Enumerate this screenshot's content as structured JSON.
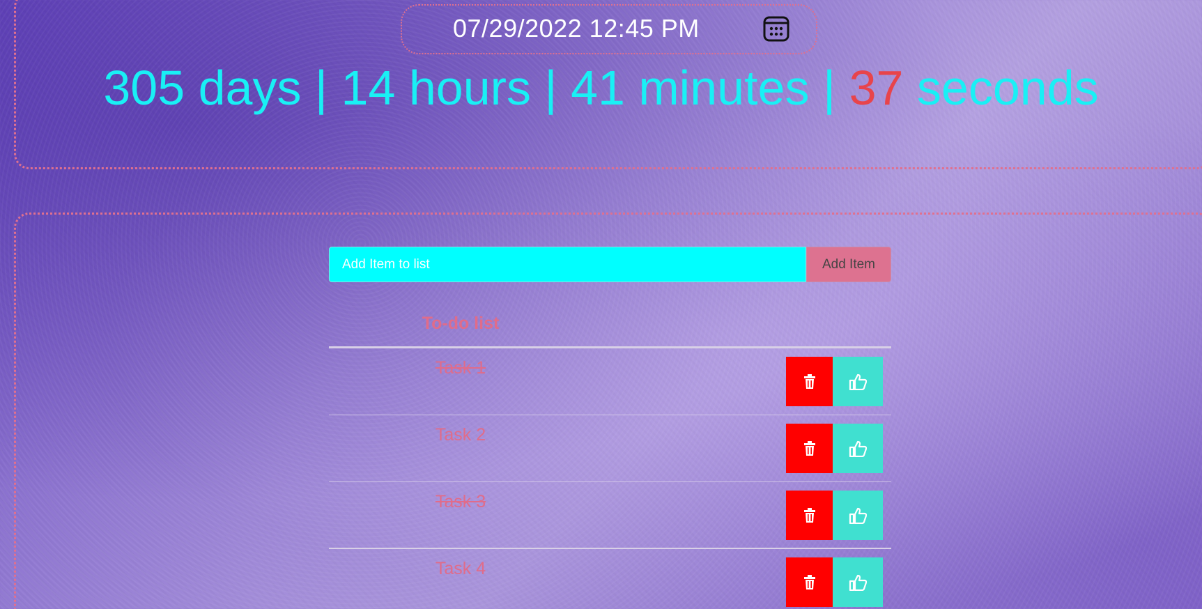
{
  "clock": {
    "datetime": "07/29/2022 12:45 PM",
    "icon": "calendar-icon"
  },
  "countdown": {
    "days": "305 days",
    "hours": "14 hours",
    "minutes": "41 minutes",
    "seconds_value": "37",
    "seconds_unit": "seconds",
    "separator": "|"
  },
  "todo": {
    "input_placeholder": "Add Item to list",
    "add_label": "Add Item",
    "list_title": "To-do list",
    "tasks": [
      {
        "label": "Task 1",
        "done": true
      },
      {
        "label": "Task 2",
        "done": false
      },
      {
        "label": "Task 3",
        "done": true
      },
      {
        "label": "Task 4",
        "done": false
      }
    ]
  },
  "colors": {
    "countdown": "#19f0f5",
    "seconds": "#e8444b",
    "input_bg": "#00ffff",
    "add_button_bg": "#dd7290",
    "accent_pink": "#e06c8a",
    "delete_bg": "#ff0000",
    "like_bg": "#40e0d0"
  }
}
